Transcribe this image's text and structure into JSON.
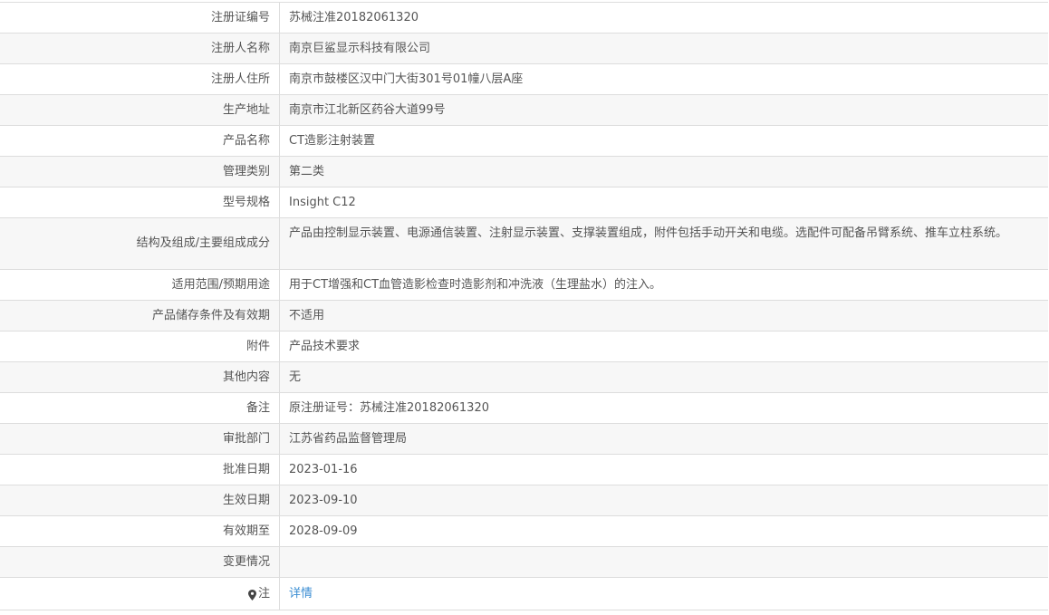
{
  "rows": [
    {
      "label": "注册证编号",
      "value": "苏械注准20182061320"
    },
    {
      "label": "注册人名称",
      "value": "南京巨鲨显示科技有限公司"
    },
    {
      "label": "注册人住所",
      "value": "南京市鼓楼区汉中门大街301号01幢八层A座"
    },
    {
      "label": "生产地址",
      "value": "南京市江北新区药谷大道99号"
    },
    {
      "label": "产品名称",
      "value": "CT造影注射装置"
    },
    {
      "label": "管理类别",
      "value": "第二类"
    },
    {
      "label": "型号规格",
      "value": "Insight C12"
    },
    {
      "label": "结构及组成/主要组成成分",
      "value": "产品由控制显示装置、电源通信装置、注射显示装置、支撑装置组成，附件包括手动开关和电缆。选配件可配备吊臂系统、推车立柱系统。"
    },
    {
      "label": "适用范围/预期用途",
      "value": "用于CT增强和CT血管造影检查时造影剂和冲洗液（生理盐水）的注入。"
    },
    {
      "label": "产品储存条件及有效期",
      "value": "不适用"
    },
    {
      "label": "附件",
      "value": "产品技术要求"
    },
    {
      "label": "其他内容",
      "value": "无"
    },
    {
      "label": "备注",
      "value": "原注册证号：苏械注准20182061320"
    },
    {
      "label": "审批部门",
      "value": "江苏省药品监督管理局"
    },
    {
      "label": "批准日期",
      "value": "2023-01-16"
    },
    {
      "label": "生效日期",
      "value": "2023-09-10"
    },
    {
      "label": "有效期至",
      "value": "2028-09-09"
    },
    {
      "label": "变更情况",
      "value": ""
    }
  ],
  "note": {
    "label": "注",
    "icon": "pin-icon",
    "link": "详情",
    "link_color": "#3b8ed3"
  }
}
